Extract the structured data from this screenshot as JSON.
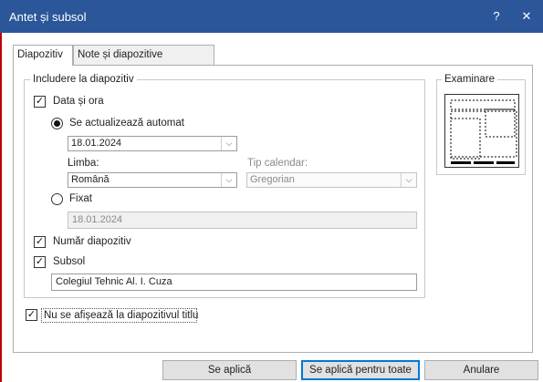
{
  "dialog": {
    "title": "Antet și subsol",
    "help_glyph": "?",
    "close_glyph": "✕"
  },
  "tabs": [
    {
      "label": "Diapozitiv",
      "active": true
    },
    {
      "label": "Note și diapozitive imprimate",
      "active": false
    }
  ],
  "include_group": {
    "legend": "Includere la diapozitiv",
    "date_time": {
      "label": "Data și ora",
      "checked": true
    },
    "auto_update": {
      "label": "Se actualizează automat",
      "selected": true,
      "date_value": "18.01.2024"
    },
    "language": {
      "label": "Limba:",
      "value": "Română"
    },
    "calendar_type": {
      "label": "Tip calendar:",
      "value": "Gregorian",
      "disabled": true
    },
    "fixed": {
      "label": "Fixat",
      "selected": false,
      "value": "18.01.2024"
    },
    "slide_number": {
      "label": "Număr diapozitiv",
      "checked": true
    },
    "footer": {
      "label": "Subsol",
      "checked": true,
      "value": "Colegiul Tehnic Al. I. Cuza"
    }
  },
  "dont_show_title": {
    "label": "Nu se afișează la diapozitivul titlu",
    "checked": true
  },
  "preview": {
    "legend": "Examinare"
  },
  "buttons": {
    "apply": "Se aplică",
    "apply_all": "Se aplică pentru toate",
    "cancel": "Anulare"
  },
  "icons": {
    "check": "✓",
    "dropdown": "⌵"
  },
  "colors": {
    "titlebar": "#2b579a",
    "accent": "#0078d7"
  }
}
